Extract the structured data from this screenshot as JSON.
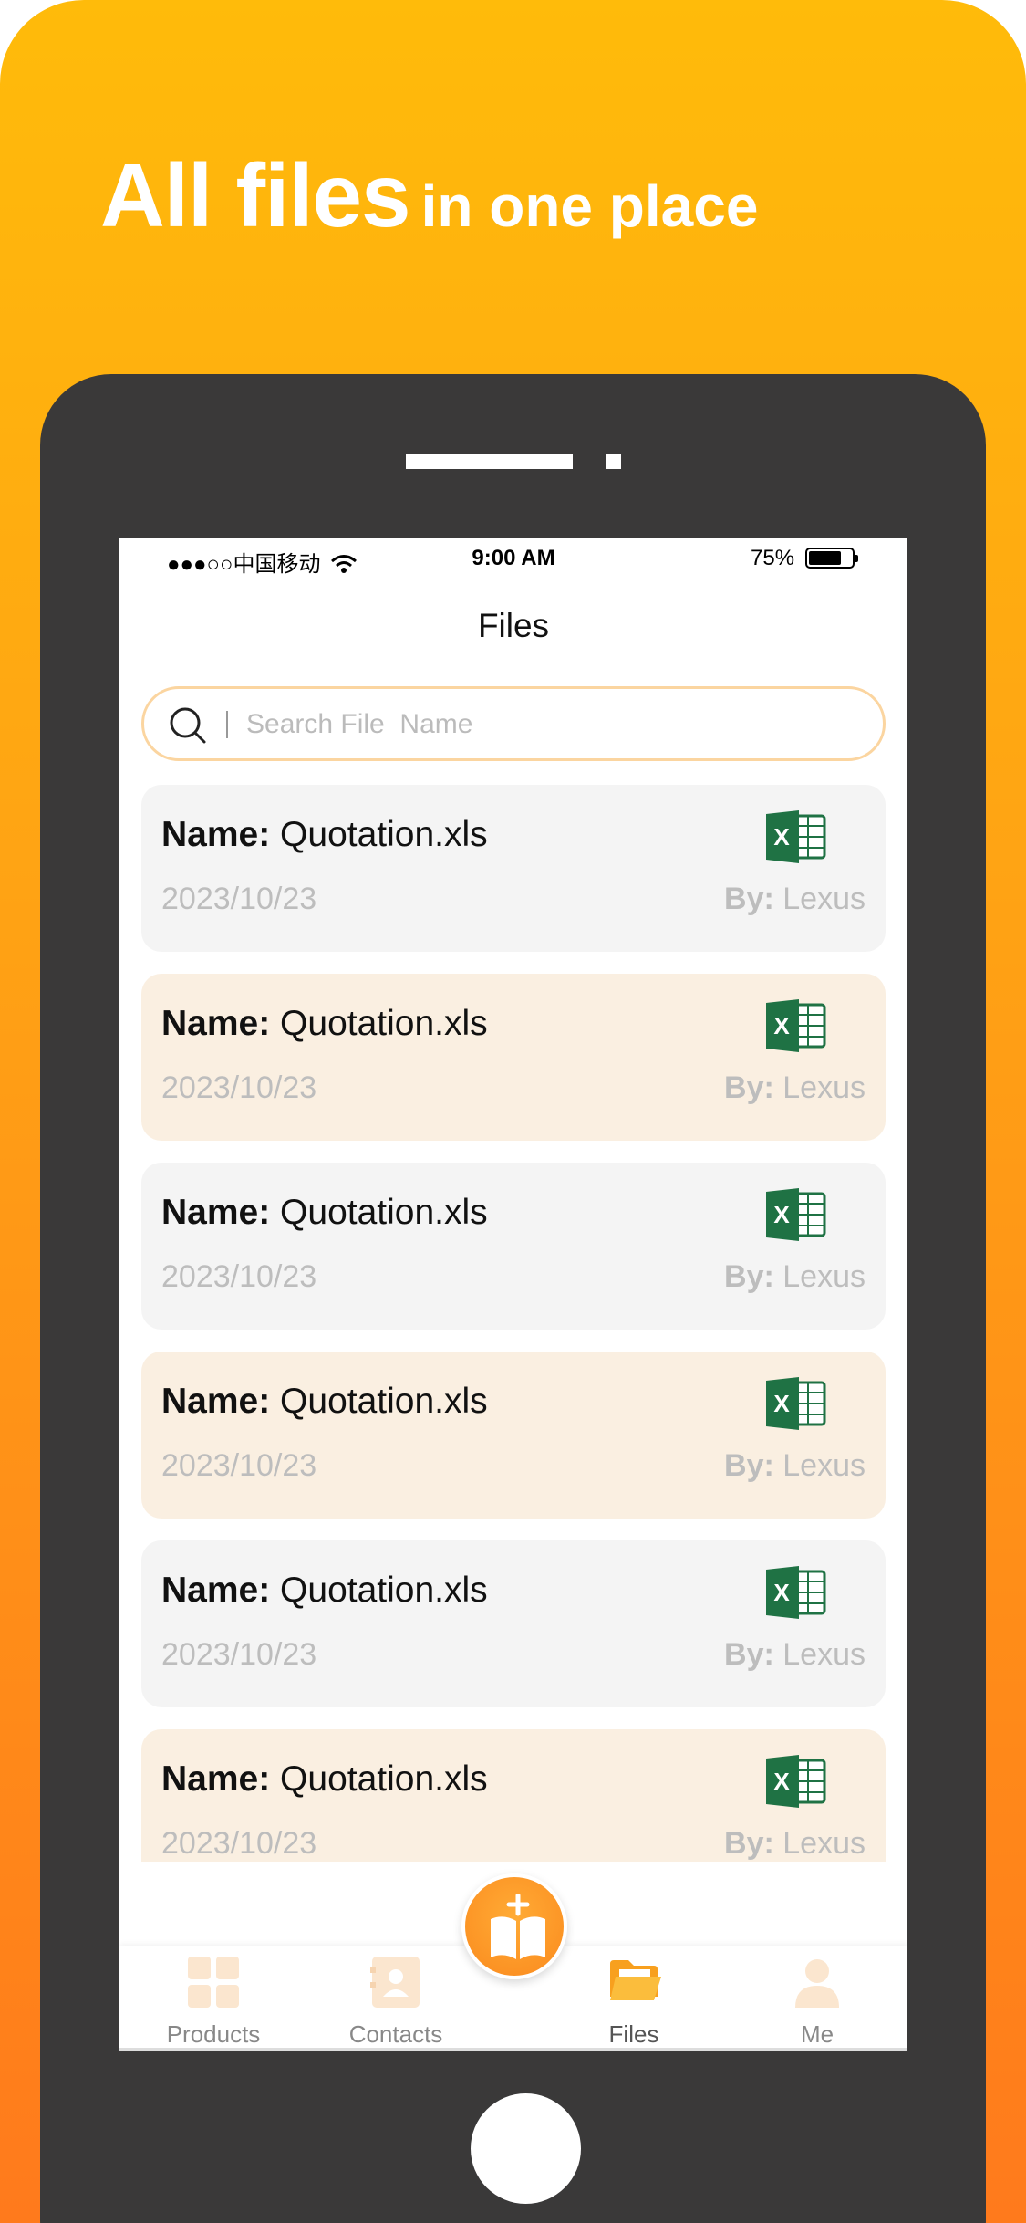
{
  "promo": {
    "headline_big": "All files",
    "headline_small": "in one place"
  },
  "status_bar": {
    "carrier": "●●●○○中国移动",
    "time": "9:00 AM",
    "battery": "75%",
    "battery_level": 0.75
  },
  "page": {
    "title": "Files"
  },
  "search": {
    "placeholder": "Search File  Name"
  },
  "files": [
    {
      "name_label": "Name:",
      "name": " Quotation.xls",
      "date": "2023/10/23",
      "by_label": "By:",
      "by": " Lexus",
      "icon": "excel-icon"
    },
    {
      "name_label": "Name:",
      "name": " Quotation.xls",
      "date": "2023/10/23",
      "by_label": "By:",
      "by": " Lexus",
      "icon": "excel-icon"
    },
    {
      "name_label": "Name:",
      "name": " Quotation.xls",
      "date": "2023/10/23",
      "by_label": "By:",
      "by": " Lexus",
      "icon": "excel-icon"
    },
    {
      "name_label": "Name:",
      "name": " Quotation.xls",
      "date": "2023/10/23",
      "by_label": "By:",
      "by": " Lexus",
      "icon": "excel-icon"
    },
    {
      "name_label": "Name:",
      "name": " Quotation.xls",
      "date": "2023/10/23",
      "by_label": "By:",
      "by": " Lexus",
      "icon": "excel-icon"
    },
    {
      "name_label": "Name:",
      "name": " Quotation.xls",
      "date": "2023/10/23",
      "by_label": "By:",
      "by": " Lexus",
      "icon": "excel-icon"
    }
  ],
  "tabbar": {
    "products": "Products",
    "contacts": "Contacts",
    "files": "Files",
    "me": "Me"
  },
  "colors": {
    "accent": "#fb8a1e",
    "card_gray": "#f4f4f4",
    "card_cream": "#faefe1",
    "excel_green": "#1f7244"
  }
}
